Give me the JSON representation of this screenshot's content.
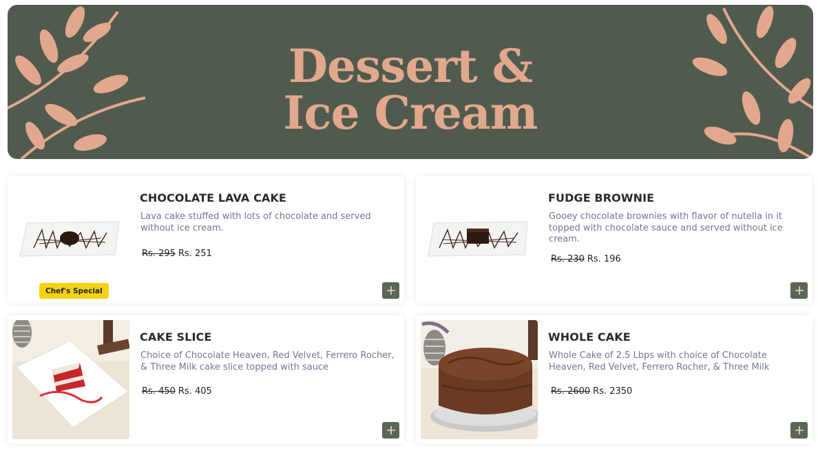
{
  "banner": {
    "line1": "Dessert &",
    "line2": "Ice Cream",
    "bg_color": "#505b4e",
    "accent_color": "#e2a88d"
  },
  "items": [
    {
      "name": "CHOCOLATE LAVA CAKE",
      "description": "Lava cake stuffed with lots of chocolate and served without ice cream.",
      "old_price": "Rs. 295",
      "price": "Rs. 251",
      "badge": "Chef's Special",
      "image": "lava-cake-plate"
    },
    {
      "name": "FUDGE BROWNIE",
      "description": "Gooey chocolate brownies with flavor of nutella in it topped with chocolate sauce and served without ice cream.",
      "old_price": "Rs. 230",
      "price": "Rs. 196",
      "image": "brownie-plate"
    },
    {
      "name": "CAKE SLICE",
      "description": "Choice of Chocolate Heaven, Red Velvet, Ferrero Rocher, & Three Milk cake slice topped with sauce",
      "old_price": "Rs. 450",
      "price": "Rs. 405",
      "image": "red-velvet-slice-photo"
    },
    {
      "name": "WHOLE CAKE",
      "description": "Whole Cake of 2.5 Lbps with choice of Chocolate Heaven, Red Velvet, Ferrero Rocher, & Three Milk",
      "old_price": "Rs. 2600",
      "price": "Rs. 2350",
      "image": "chocolate-cake-photo"
    }
  ],
  "add_icon": "plus-icon",
  "colors": {
    "add_button": "#5a6657",
    "badge": "#f5d312",
    "description": "#717791"
  }
}
